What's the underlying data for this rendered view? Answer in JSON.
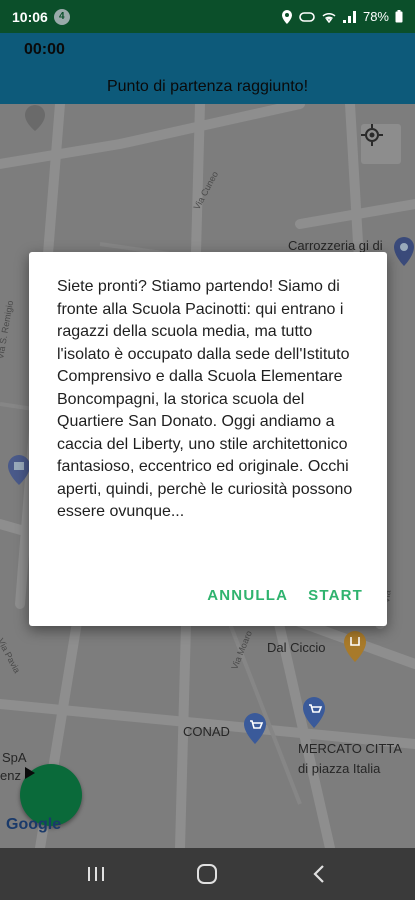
{
  "status_bar": {
    "time": "10:06",
    "notification_count": "4",
    "battery": "78%"
  },
  "header": {
    "timer": "00:00",
    "banner": "Punto di partenza raggiunto!"
  },
  "map": {
    "labels": {
      "carrozzeria": "Carrozzeria gi di",
      "dal_ciccio": "Dal Ciccio",
      "conad": "CONAD",
      "mercato_line1": "MERCATO CITTA",
      "mercato_line2": "di piazza Italia",
      "spa_line1": "SpA",
      "spa_line2": "enz",
      "street_cuneo": "Via Cuneo",
      "street_s_remigio": "Via S. Remigio",
      "street_pavia": "Via Pavia",
      "street_mazzini": "Via Mazzini",
      "street_moaro": "Via Moaro",
      "street_vercelli": "Via",
      "google": "Google"
    }
  },
  "dialog": {
    "message": "Siete pronti? Stiamo partendo! Siamo di fronte alla Scuola Pacinotti: qui entrano i ragazzi della scuola media, ma tutto l'isolato è occupato dalla sede dell'Istituto Comprensivo e dalla Scuola Elementare Boncompagni, la storica scuola del Quartiere San Donato. Oggi andiamo a caccia del Liberty, uno stile architettonico fantasioso, eccentrico ed originale. Occhi aperti, quindi, perchè le curiosità possono essere ovunque...",
    "cancel_label": "ANNULLA",
    "start_label": "START"
  },
  "colors": {
    "status_bar": "#0b4f2a",
    "header": "#0d5a7a",
    "accent": "#2fb36e",
    "fab": "#0a6a3a"
  },
  "icons": {
    "location": "location-pin-icon",
    "my_location": "my-location-icon",
    "play": "play-icon",
    "nav_recents": "recents-icon",
    "nav_home": "home-icon",
    "nav_back": "back-icon"
  }
}
